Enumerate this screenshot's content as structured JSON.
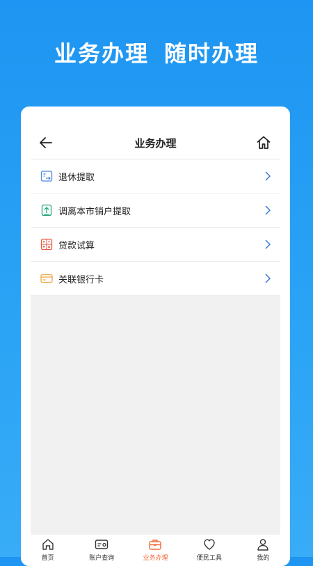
{
  "hero": {
    "title_left": "业务办理",
    "title_right": "随时办理"
  },
  "nav": {
    "title": "业务办理",
    "back_icon": "arrow-left-icon",
    "home_icon": "home-icon"
  },
  "menu": {
    "items": [
      {
        "label": "退休提取",
        "icon": "retirement-doc-icon",
        "icon_color": "#4a86e8"
      },
      {
        "label": "调离本市销户提取",
        "icon": "transfer-up-icon",
        "icon_color": "#20a87a"
      },
      {
        "label": "贷款试算",
        "icon": "calculator-icon",
        "icon_color": "#e8573f"
      },
      {
        "label": "关联银行卡",
        "icon": "bank-card-icon",
        "icon_color": "#f0a640"
      }
    ]
  },
  "tabs": [
    {
      "label": "首页",
      "icon": "home-icon",
      "active": false
    },
    {
      "label": "账户查询",
      "icon": "account-card-icon",
      "active": false
    },
    {
      "label": "业务办理",
      "icon": "briefcase-icon",
      "active": true
    },
    {
      "label": "便民工具",
      "icon": "heart-icon",
      "active": false
    },
    {
      "label": "我的",
      "icon": "user-icon",
      "active": false
    }
  ],
  "colors": {
    "brand_blue": "#1e95f2",
    "active_tab": "#f06a3c",
    "chevron": "#3a78d8"
  }
}
